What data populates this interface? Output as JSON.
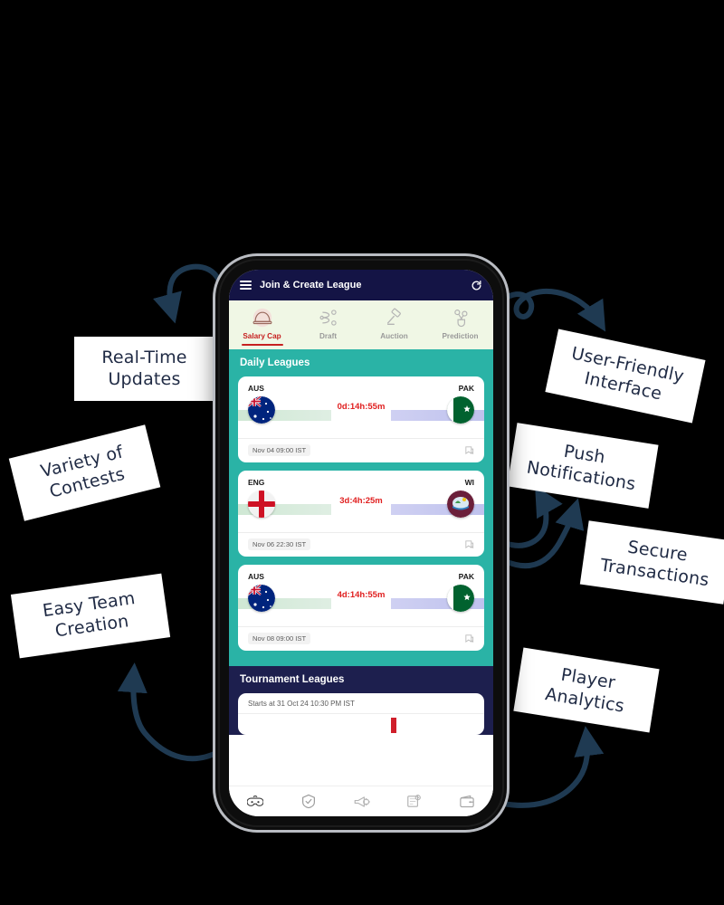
{
  "phone": {
    "appbar": {
      "menu_icon": "hamburger-menu-icon",
      "title": "Join & Create League",
      "refresh_icon": "refresh-icon"
    },
    "modes": [
      {
        "label": "Salary Cap",
        "icon": "cap-icon",
        "active": true
      },
      {
        "label": "Draft",
        "icon": "draft-icon",
        "active": false
      },
      {
        "label": "Auction",
        "icon": "gavel-icon",
        "active": false
      },
      {
        "label": "Prediction",
        "icon": "scissors-icon",
        "active": false
      }
    ],
    "daily_leagues": {
      "title": "Daily Leagues",
      "matches": [
        {
          "home": "AUS",
          "away": "PAK",
          "timer": "0d:14h:55m",
          "date": "Nov 04 09:00 IST",
          "home_flag": "australia-flag",
          "away_flag": "pakistan-flag",
          "bookmark_icon": "save-icon"
        },
        {
          "home": "ENG",
          "away": "WI",
          "timer": "3d:4h:25m",
          "date": "Nov 06 22:30 IST",
          "home_flag": "england-flag",
          "away_flag": "westindies-flag",
          "bookmark_icon": "save-icon"
        },
        {
          "home": "AUS",
          "away": "PAK",
          "timer": "4d:14h:55m",
          "date": "Nov 08 09:00 IST",
          "home_flag": "australia-flag",
          "away_flag": "pakistan-flag",
          "bookmark_icon": "save-icon"
        }
      ]
    },
    "tournament_leagues": {
      "title": "Tournament Leagues",
      "card": {
        "starts_at": "Starts at 31 Oct 24 10:30 PM IST"
      }
    },
    "bottom_nav": [
      {
        "icon": "game-controller-icon"
      },
      {
        "icon": "shield-check-icon"
      },
      {
        "icon": "megaphone-icon"
      },
      {
        "icon": "scoreboard-icon"
      },
      {
        "icon": "wallet-icon"
      }
    ]
  },
  "callouts": [
    {
      "id": "real-time-updates",
      "text": "Real-Time\nUpdates"
    },
    {
      "id": "variety-of-contests",
      "text": "Variety of\nContests"
    },
    {
      "id": "easy-team-creation",
      "text": "Easy Team\nCreation"
    },
    {
      "id": "user-friendly-interface",
      "text": "User-Friendly\nInterface"
    },
    {
      "id": "push-notifications",
      "text": "Push\nNotifications"
    },
    {
      "id": "secure-transactions",
      "text": "Secure\nTransactions"
    },
    {
      "id": "player-analytics",
      "text": "Player\nAnalytics"
    }
  ],
  "colors": {
    "background": "#000000",
    "appbar": "#141445",
    "daily_section": "#2ab3a6",
    "tournament_section": "#1d1f4e",
    "accent_red": "#c62020",
    "timer_red": "#e02020",
    "mode_bar": "#f0f7e5",
    "arrow": "#1f3a52",
    "callout_text": "#1f2a44"
  }
}
